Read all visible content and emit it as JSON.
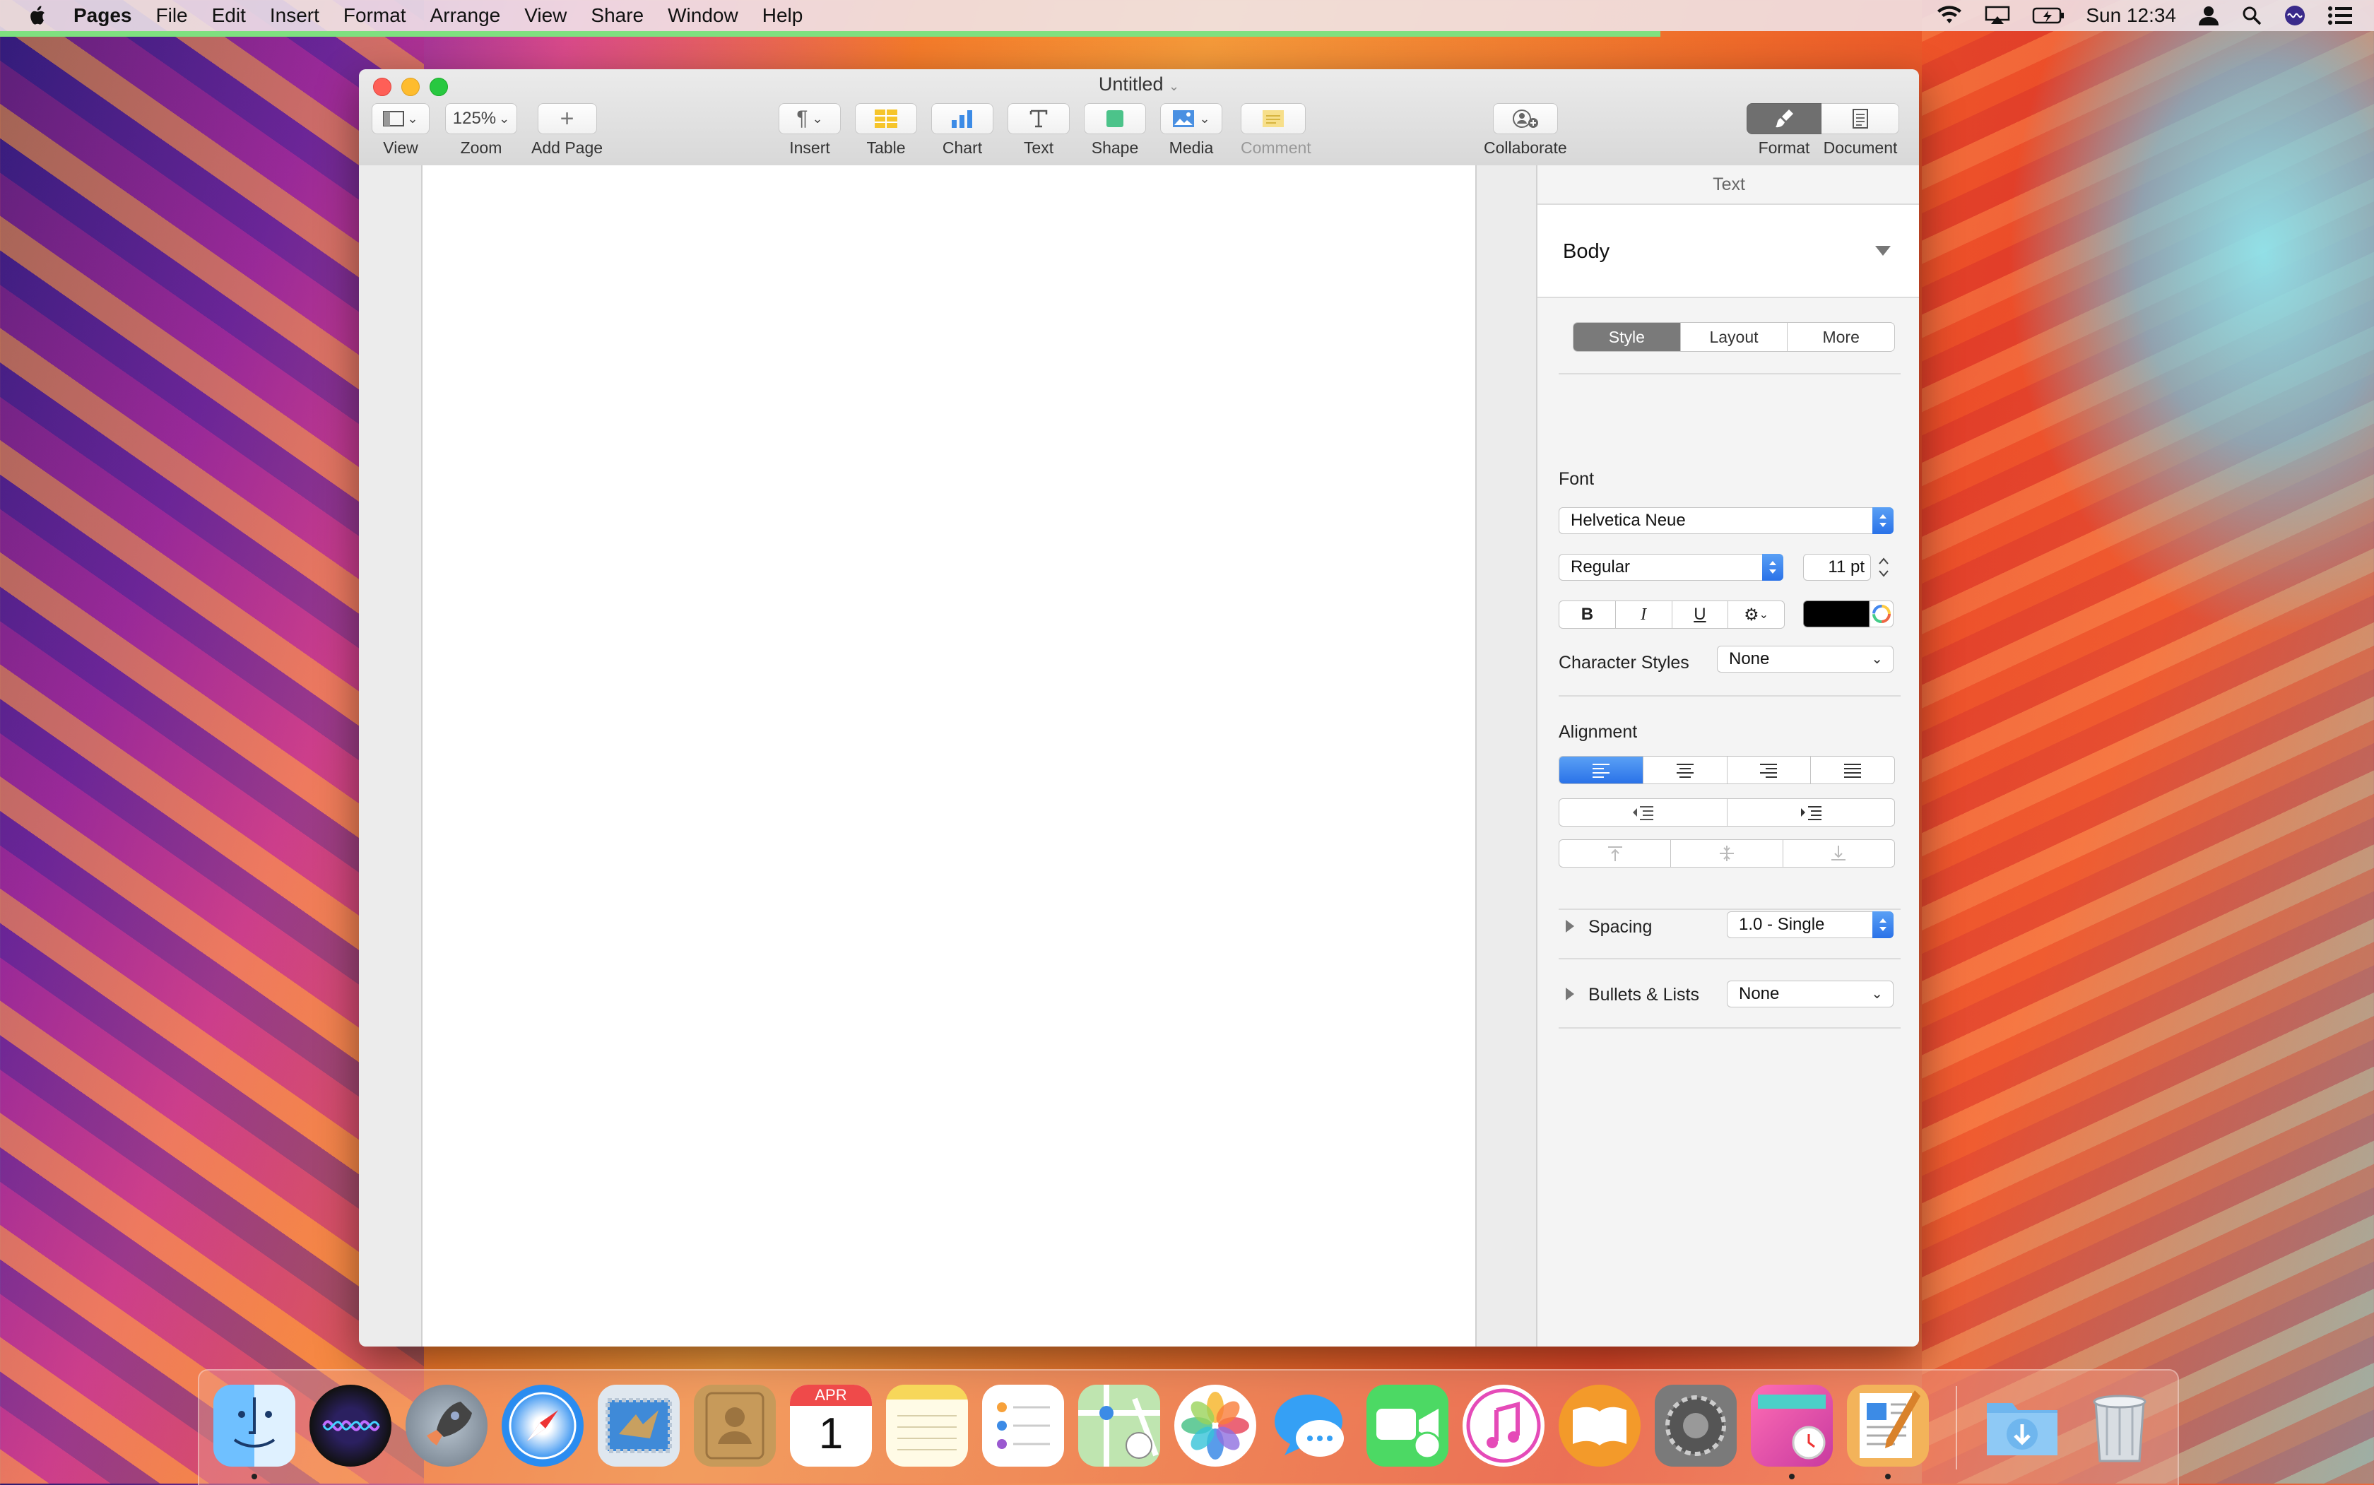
{
  "menubar": {
    "app": "Pages",
    "items": [
      "File",
      "Edit",
      "Insert",
      "Format",
      "Arrange",
      "View",
      "Share",
      "Window",
      "Help"
    ],
    "clock": "Sun 12:34"
  },
  "window": {
    "title": "Untitled",
    "toolbar": {
      "view": "View",
      "zoom_value": "125%",
      "zoom": "Zoom",
      "add_page": "Add Page",
      "insert": "Insert",
      "table": "Table",
      "chart": "Chart",
      "text": "Text",
      "shape": "Shape",
      "media": "Media",
      "comment": "Comment",
      "collaborate": "Collaborate",
      "format": "Format",
      "document": "Document"
    }
  },
  "inspector": {
    "header": "Text",
    "paragraph_style": "Body",
    "tabs": [
      "Style",
      "Layout",
      "More"
    ],
    "font_label": "Font",
    "font_family": "Helvetica Neue",
    "font_typeface": "Regular",
    "font_size": "11 pt",
    "bold": "B",
    "italic": "I",
    "underline": "U",
    "text_color": "#000000",
    "character_styles_label": "Character Styles",
    "character_styles_value": "None",
    "alignment_label": "Alignment",
    "spacing_label": "Spacing",
    "spacing_value": "1.0 - Single",
    "bullets_label": "Bullets & Lists",
    "bullets_value": "None"
  },
  "dock": {
    "apps": [
      "finder-icon",
      "siri-icon",
      "launchpad-icon",
      "safari-icon",
      "mail-icon",
      "contacts-icon",
      "calendar-icon",
      "notes-icon",
      "reminders-icon",
      "maps-icon",
      "photos-icon",
      "messages-icon",
      "facetime-icon",
      "itunes-icon",
      "ibooks-icon",
      "system-preferences-icon",
      "screen-time-icon",
      "pages-icon",
      "downloads-folder-icon",
      "trash-icon"
    ],
    "calendar_month": "APR",
    "calendar_day": "1"
  },
  "colors": {
    "accent_blue": "#2a72e8",
    "close": "#fe5f57",
    "minimize": "#febc2e",
    "zoom": "#28c840"
  }
}
